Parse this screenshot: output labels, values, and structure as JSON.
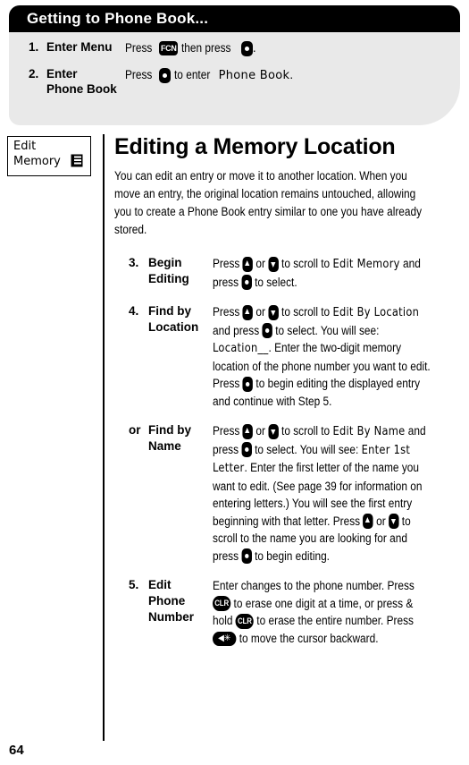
{
  "top_panel": {
    "header_title": "Getting to Phone Book...",
    "steps": [
      {
        "num": "1.",
        "label": "Enter Menu",
        "text_pre": "Press",
        "key1": "FCN",
        "text_mid": "then press",
        "key2": "ok",
        "text_post": "."
      },
      {
        "num": "2.",
        "label_line1": "Enter",
        "label_line2": "Phone Book",
        "text_pre": "Press",
        "key1": "ok",
        "text_mid": "to enter",
        "display": "Phone Book",
        "text_post": "."
      }
    ]
  },
  "icon_box": {
    "line1": "Edit",
    "line2": "Memory",
    "icon": "phone-book-icon"
  },
  "main": {
    "title": "Editing a Memory Location",
    "intro": "You can edit an entry or move it to another location. When you move an entry, the original location remains untouched, allowing you to create a Phone Book entry similar to one you have already stored.",
    "steps": [
      {
        "num": "3.",
        "label_line1": "Begin",
        "label_line2": "Editing",
        "parts": [
          {
            "t": "text",
            "v": "Press "
          },
          {
            "t": "key",
            "v": "up"
          },
          {
            "t": "text",
            "v": " or "
          },
          {
            "t": "key",
            "v": "down"
          },
          {
            "t": "text",
            "v": " to scroll to "
          },
          {
            "t": "lcd",
            "v": "Edit Memory"
          },
          {
            "t": "text",
            "v": " and press "
          },
          {
            "t": "key",
            "v": "ok"
          },
          {
            "t": "text",
            "v": " to select."
          }
        ]
      },
      {
        "num": "4.",
        "label_line1": "Find by",
        "label_line2": "Location",
        "parts": [
          {
            "t": "text",
            "v": "Press "
          },
          {
            "t": "key",
            "v": "up"
          },
          {
            "t": "text",
            "v": " or "
          },
          {
            "t": "key",
            "v": "down"
          },
          {
            "t": "text",
            "v": " to scroll to "
          },
          {
            "t": "lcd",
            "v": "Edit By Location"
          },
          {
            "t": "text",
            "v": " and press "
          },
          {
            "t": "key",
            "v": "ok"
          },
          {
            "t": "text",
            "v": " to select. You will see: "
          },
          {
            "t": "lcd",
            "v": "Location__"
          },
          {
            "t": "text",
            "v": ". Enter the two-digit memory location of the phone number you want to edit. Press "
          },
          {
            "t": "key",
            "v": "ok"
          },
          {
            "t": "text",
            "v": " to begin editing the displayed entry and continue with Step 5."
          }
        ]
      },
      {
        "num": "or",
        "label_line1": "Find by",
        "label_line2": "Name",
        "parts": [
          {
            "t": "text",
            "v": "Press "
          },
          {
            "t": "key",
            "v": "up"
          },
          {
            "t": "text",
            "v": " or "
          },
          {
            "t": "key",
            "v": "down"
          },
          {
            "t": "text",
            "v": " to scroll to "
          },
          {
            "t": "lcd",
            "v": "Edit By Name"
          },
          {
            "t": "text",
            "v": " and press "
          },
          {
            "t": "key",
            "v": "ok"
          },
          {
            "t": "text",
            "v": " to select. You will see: "
          },
          {
            "t": "lcd",
            "v": "Enter 1st Letter"
          },
          {
            "t": "text",
            "v": ". Enter the first letter of the name you want to edit. (See page 39 for information on entering letters.) You will see the first entry beginning with that letter. Press "
          },
          {
            "t": "key",
            "v": "up"
          },
          {
            "t": "text",
            "v": " or "
          },
          {
            "t": "key",
            "v": "down"
          },
          {
            "t": "text",
            "v": " to scroll to the name you are looking for and press "
          },
          {
            "t": "key",
            "v": "ok"
          },
          {
            "t": "text",
            "v": " to begin editing."
          }
        ]
      },
      {
        "num": "5.",
        "label_line1": "Edit",
        "label_line2": "Phone",
        "label_line3": "Number",
        "parts": [
          {
            "t": "text",
            "v": "Enter changes to the phone number. Press "
          },
          {
            "t": "key",
            "v": "CLR"
          },
          {
            "t": "text",
            "v": " to erase one digit at a time, or press & hold "
          },
          {
            "t": "key",
            "v": "CLR"
          },
          {
            "t": "text",
            "v": " to erase the entire number. Press "
          },
          {
            "t": "key",
            "v": "star"
          },
          {
            "t": "text",
            "v": " to move the cursor backward."
          }
        ]
      }
    ]
  },
  "page_number": "64"
}
